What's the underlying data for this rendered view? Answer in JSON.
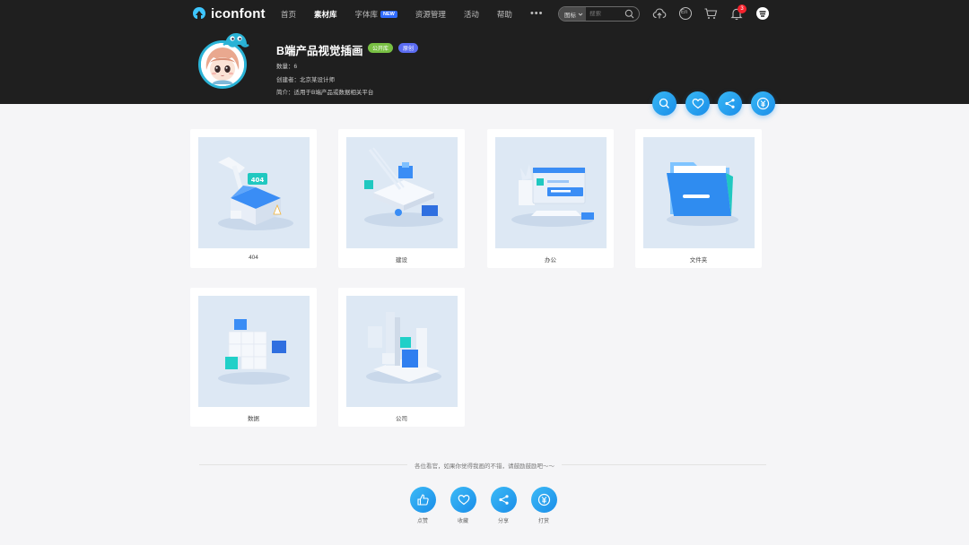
{
  "nav": {
    "logo_text": "iconfont",
    "menu": [
      {
        "label": "首页",
        "active": false
      },
      {
        "label": "素材库",
        "active": true
      },
      {
        "label": "字体库",
        "active": false,
        "badge": "NEW"
      },
      {
        "label": "资源管理",
        "active": false
      },
      {
        "label": "活动",
        "active": false
      },
      {
        "label": "帮助",
        "active": false
      }
    ],
    "more": "•••",
    "search_type": "图标",
    "search_placeholder": "搜索",
    "notification_count": "3",
    "lang_label": "En"
  },
  "collection": {
    "title": "B端产品视觉插画",
    "tag_public": "公开库",
    "tag_original": "原创",
    "count_line": "数量：6",
    "creator_line": "创建者：北京某设计师",
    "desc_line": "简介：适用于B端产品或数据相关平台"
  },
  "cards": [
    {
      "label": "404"
    },
    {
      "label": "建设"
    },
    {
      "label": "办公"
    },
    {
      "label": "文件夹"
    },
    {
      "label": "数据"
    },
    {
      "label": "公司"
    }
  ],
  "footer": {
    "message": "各位看官，如果你觉得我画的不错，请鼓励鼓励吧～～",
    "actions": [
      {
        "label": "点赞",
        "icon": "thumbs-up-icon"
      },
      {
        "label": "收藏",
        "icon": "heart-icon"
      },
      {
        "label": "分享",
        "icon": "share-icon"
      },
      {
        "label": "打赏",
        "icon": "reward-icon"
      }
    ]
  },
  "colors": {
    "header_bg": "#1f1f1f",
    "accent": "#1a8de9",
    "tag_public": "#78c043",
    "tag_original": "#5b6cf2"
  }
}
